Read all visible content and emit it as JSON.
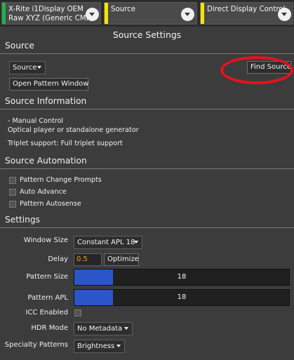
{
  "tabs": [
    {
      "line1": "X-Rite i1Display OEM",
      "line2": "Raw XYZ (Generic CMF)",
      "stripe_color": "#22b14c"
    },
    {
      "line1": "Source",
      "line2": "",
      "stripe_color": "#f2e600"
    },
    {
      "line1": "Direct Display Control",
      "line2": "",
      "stripe_color": "#f2e600"
    }
  ],
  "panel_title": "Source Settings",
  "source_section": {
    "heading": "Source",
    "source_combo": "Source",
    "find_source_button": "Find Source",
    "open_pattern_button": "Open Pattern Window"
  },
  "source_info": {
    "heading": "Source Information",
    "lines": [
      "- Manual Control",
      "Optical player or standalone generator",
      "Triplet support: Full triplet support"
    ]
  },
  "automation": {
    "heading": "Source Automation",
    "options": [
      {
        "label": "Pattern Change Prompts",
        "checked": false
      },
      {
        "label": "Auto Advance",
        "checked": false
      },
      {
        "label": "Pattern Autosense",
        "checked": false
      }
    ]
  },
  "settings": {
    "heading": "Settings",
    "window_size_label": "Window Size",
    "window_size_value": "Constant APL 18",
    "delay_label": "Delay",
    "delay_value": "0.5",
    "optimize_button": "Optimize",
    "pattern_size_label": "Pattern Size",
    "pattern_size_value": "18",
    "pattern_apl_label": "Pattern APL",
    "pattern_apl_value": "18",
    "slider_range": [
      0,
      100
    ],
    "icc_label": "ICC Enabled",
    "icc_checked": false,
    "hdr_label": "HDR Mode",
    "hdr_value": "No Metadata",
    "specialty_label": "Specialty Patterns",
    "specialty_value": "Brightness"
  },
  "colors": {
    "slider_fill": "#2a56c7",
    "delay_text": "#f0a020",
    "highlight_annotation": "#e8111d"
  }
}
